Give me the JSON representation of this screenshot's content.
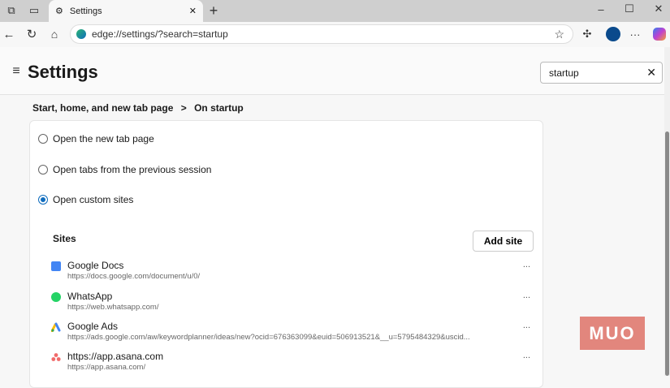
{
  "browser": {
    "tab_title": "Settings",
    "address": "edge://settings/?search=startup"
  },
  "header": {
    "title": "Settings",
    "search_value": "startup"
  },
  "breadcrumb": {
    "parent": "Start, home, and new tab page",
    "separator": ">",
    "current": "On startup"
  },
  "options": [
    {
      "label": "Open the new tab page",
      "selected": false
    },
    {
      "label": "Open tabs from the previous session",
      "selected": false
    },
    {
      "label": "Open custom sites",
      "selected": true
    }
  ],
  "sites": {
    "heading": "Sites",
    "add_label": "Add site",
    "items": [
      {
        "name": "Google Docs",
        "url": "https://docs.google.com/document/u/0/",
        "more": "..."
      },
      {
        "name": "WhatsApp",
        "url": "https://web.whatsapp.com/",
        "more": "..."
      },
      {
        "name": "Google Ads",
        "url": "https://ads.google.com/aw/keywordplanner/ideas/new?ocid=676363099&euid=506913521&__u=5795484329&uscid...",
        "more": "..."
      },
      {
        "name": "https://app.asana.com",
        "url": "https://app.asana.com/",
        "more": "..."
      }
    ]
  },
  "watermark": "MUO"
}
